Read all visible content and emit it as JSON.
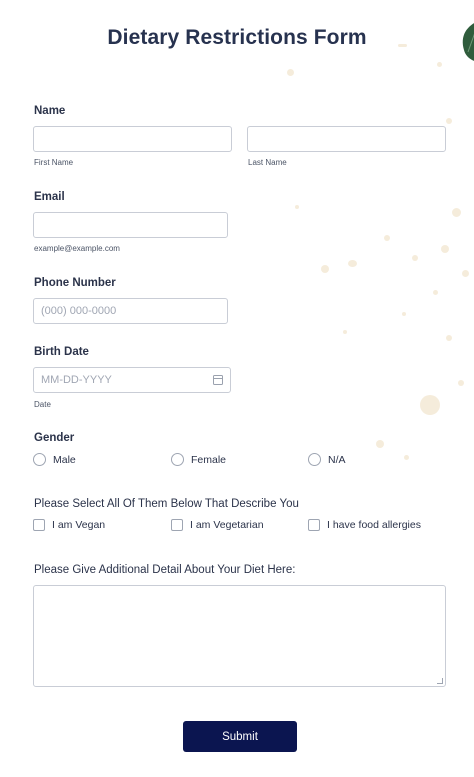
{
  "form": {
    "title": "Dietary Restrictions Form",
    "name": {
      "label": "Name",
      "first_placeholder": "",
      "first_sublabel": "First Name",
      "last_placeholder": "",
      "last_sublabel": "Last Name"
    },
    "email": {
      "label": "Email",
      "placeholder": "",
      "sublabel": "example@example.com"
    },
    "phone": {
      "label": "Phone Number",
      "placeholder": "(000) 000-0000"
    },
    "birth_date": {
      "label": "Birth Date",
      "placeholder": "MM-DD-YYYY",
      "sublabel": "Date",
      "icon": "calendar-icon"
    },
    "gender": {
      "label": "Gender",
      "options": [
        "Male",
        "Female",
        "N/A"
      ]
    },
    "diet": {
      "label": "Please Select All Of Them Below That Describe You",
      "options": [
        "I am Vegan",
        "I am Vegetarian",
        "I have food allergies"
      ]
    },
    "details": {
      "label": "Please Give Additional Detail About Your Diet Here:",
      "value": ""
    },
    "submit_label": "Submit"
  },
  "colors": {
    "title": "#27324f",
    "submit_bg": "#0b1550",
    "border": "#c9cdd6",
    "decoration": "#f1e6cf",
    "leaf": "#2f5c3c"
  }
}
